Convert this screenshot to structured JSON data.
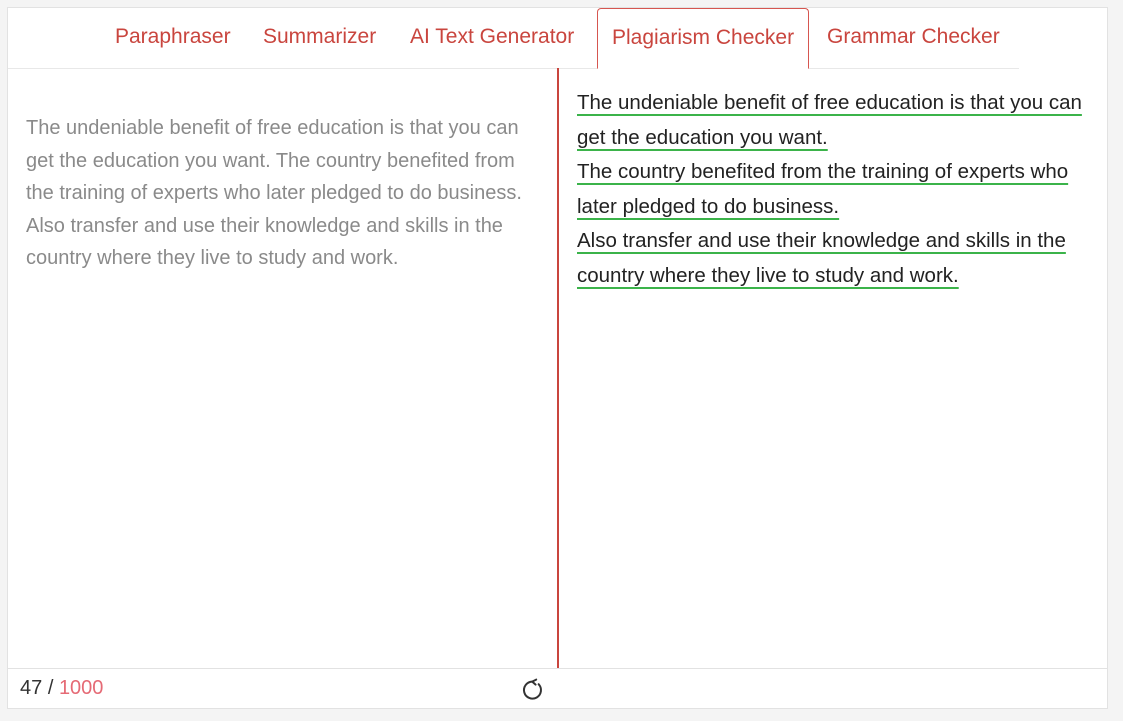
{
  "tabs": [
    {
      "label": "Paraphraser"
    },
    {
      "label": "Summarizer"
    },
    {
      "label": "AI Text Generator"
    },
    {
      "label": "Plagiarism Checker",
      "active": true
    },
    {
      "label": "Grammar Checker"
    }
  ],
  "editor": {
    "input_text": "The undeniable benefit of free education is that you can get the education you want. The country benefited from the training of experts who later pledged to do business. Also transfer and use their knowledge and skills in the country where they live to study and work."
  },
  "result": {
    "sentences": [
      "The undeniable benefit of free education is that you can get the education you want.",
      "The country benefited from the training of experts who later pledged to do business.",
      "Also transfer and use their knowledge and skills in the country where they live to study and work."
    ]
  },
  "footer": {
    "word_count": "47",
    "separator": "/",
    "max_words": "1000",
    "refresh_icon": "refresh-icon"
  },
  "colors": {
    "accent": "#c9453e",
    "underline": "#3bb34a",
    "max_count": "#e56a75"
  }
}
